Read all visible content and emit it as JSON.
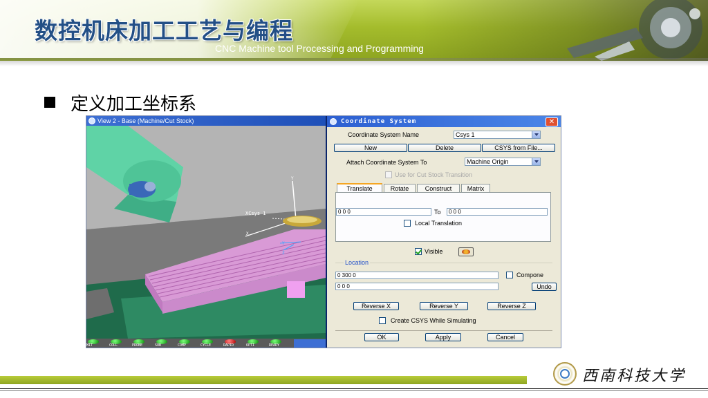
{
  "header": {
    "title": "数控机床加工工艺与编程",
    "subtitle": "CNC Machine tool Processing and Programming"
  },
  "section": {
    "title": "定义加工坐标系"
  },
  "viewport": {
    "window_title": "View 2 - Base (Machine/Cut Stock)",
    "csys_label": "XCsys 1",
    "axis_labels": {
      "y": "Y",
      "x": "X",
      "y2": "Y",
      "z": "Z"
    },
    "status_lights": [
      {
        "label": "MIT",
        "color": "green"
      },
      {
        "label": "COLL",
        "color": "green"
      },
      {
        "label": "PROBE",
        "color": "green"
      },
      {
        "label": "SUB",
        "color": "green"
      },
      {
        "label": "COMP",
        "color": "green"
      },
      {
        "label": "CYCLE",
        "color": "green"
      },
      {
        "label": "RAPID",
        "color": "red"
      },
      {
        "label": "OPTI",
        "color": "green"
      },
      {
        "label": "READY",
        "color": "green"
      }
    ]
  },
  "dialog": {
    "title": "Coordinate System",
    "csys_name_label": "Coordinate System Name",
    "csys_name_value": "Csys 1",
    "buttons": {
      "new": "New",
      "delete": "Delete",
      "from_file": "CSYS from File..."
    },
    "attach_label": "Attach Coordinate System To",
    "attach_value": "Machine Origin",
    "cut_stock_label": "Use for Cut Stock Transition",
    "tabs": [
      "Translate",
      "Rotate",
      "Construct",
      "Matrix"
    ],
    "translate": {
      "from_value": "0 0 0",
      "to_label": "To",
      "to_value": "0 0 0",
      "local_translation_label": "Local Translation"
    },
    "visible_label": "Visible",
    "location": {
      "group_label": "Location",
      "value1": "0 300 0",
      "component_label": "Compone",
      "value2": "0 0 0",
      "undo_label": "Undo"
    },
    "reverse": {
      "x": "Reverse X",
      "y": "Reverse Y",
      "z": "Reverse Z"
    },
    "create_csys_label": "Create CSYS While Simulating",
    "actions": {
      "ok": "OK",
      "apply": "Apply",
      "cancel": "Cancel"
    }
  },
  "footer": {
    "logo_text": "西南科技大学"
  },
  "colors": {
    "header_green": "#a4bc2c",
    "title_blue": "#234f86",
    "xp_blue": "#2c5fd1",
    "dialog_bg": "#ece9d8",
    "part_pink": "#d99ad6",
    "fixture_teal": "#5fd3a6"
  }
}
